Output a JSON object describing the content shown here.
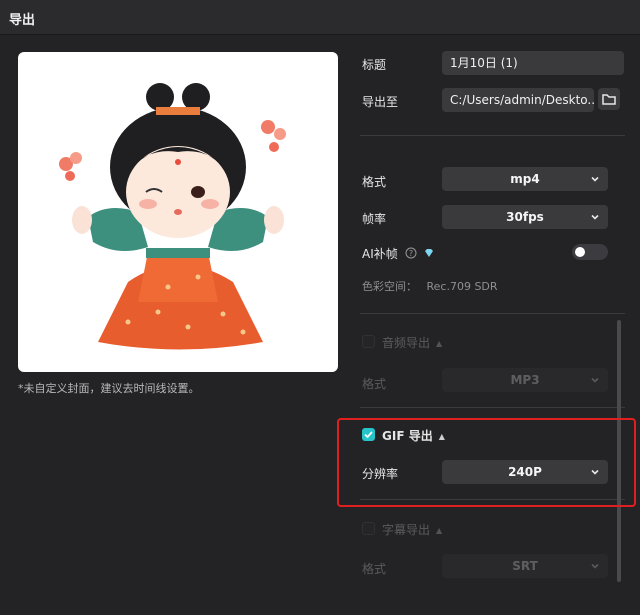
{
  "window": {
    "title": "导出"
  },
  "cover": {
    "note": "*未自定义封面，建议去时间线设置。",
    "image": "cartoon-girl-figurine"
  },
  "form": {
    "title_label": "标题",
    "title_value": "1月10日 (1)",
    "export_to_label": "导出至",
    "export_path": "C:/Users/admin/Deskto...",
    "format_label": "格式",
    "format_value": "mp4",
    "fps_label": "帧率",
    "fps_value": "30fps",
    "ai_frame_label": "AI补帧",
    "color_space_label": "色彩空间：",
    "color_space_value": "Rec.709 SDR"
  },
  "audio_section": {
    "label": "音频导出",
    "format_label": "格式",
    "format_value": "MP3",
    "checked": false
  },
  "gif_section": {
    "label": "GIF 导出",
    "resolution_label": "分辨率",
    "resolution_value": "240P",
    "checked": true
  },
  "subtitle_section": {
    "label": "字幕导出",
    "format_label": "格式",
    "format_value": "SRT",
    "checked": false
  },
  "colors": {
    "accent": "#27c4c9",
    "highlight": "#e02020",
    "background": "#232325"
  }
}
